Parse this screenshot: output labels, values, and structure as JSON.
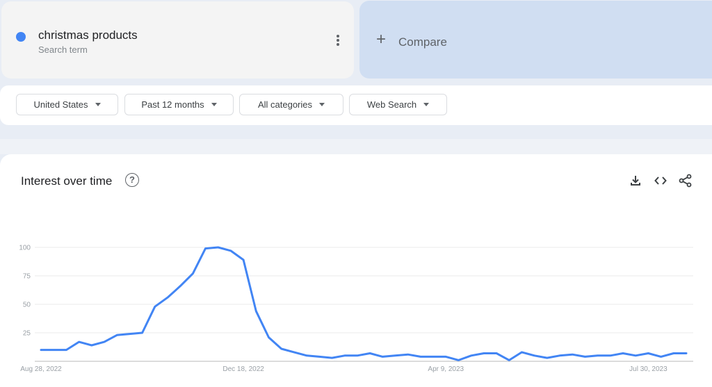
{
  "search_term": {
    "label": "christmas products",
    "sublabel": "Search term",
    "color": "#4285f4"
  },
  "compare": {
    "plus": "+",
    "label": "Compare"
  },
  "filters": [
    {
      "label": "United States"
    },
    {
      "label": "Past 12 months"
    },
    {
      "label": "All categories"
    },
    {
      "label": "Web Search"
    }
  ],
  "interest_card": {
    "title": "Interest over time",
    "help": "?",
    "tools": [
      "download-icon",
      "embed-code-icon",
      "share-icon"
    ]
  },
  "chart_data": {
    "type": "line",
    "title": "Interest over time",
    "xlabel": "",
    "ylabel": "",
    "ylim": [
      0,
      100
    ],
    "yticks": [
      25,
      50,
      75,
      100
    ],
    "grid": true,
    "x_tick_labels": [
      {
        "index": 0,
        "label": "Aug 28, 2022"
      },
      {
        "index": 16,
        "label": "Dec 18, 2022"
      },
      {
        "index": 32,
        "label": "Apr 9, 2023"
      },
      {
        "index": 48,
        "label": "Jul 30, 2023"
      }
    ],
    "series": [
      {
        "name": "christmas products",
        "color": "#4285f4",
        "values": [
          10,
          10,
          10,
          17,
          14,
          17,
          23,
          24,
          25,
          48,
          56,
          66,
          77,
          99,
          100,
          97,
          89,
          44,
          21,
          11,
          8,
          5,
          4,
          3,
          5,
          5,
          7,
          4,
          5,
          6,
          4,
          4,
          4,
          1,
          5,
          7,
          7,
          1,
          8,
          5,
          3,
          5,
          6,
          4,
          5,
          5,
          7,
          5,
          7,
          4,
          7,
          7
        ]
      }
    ]
  }
}
